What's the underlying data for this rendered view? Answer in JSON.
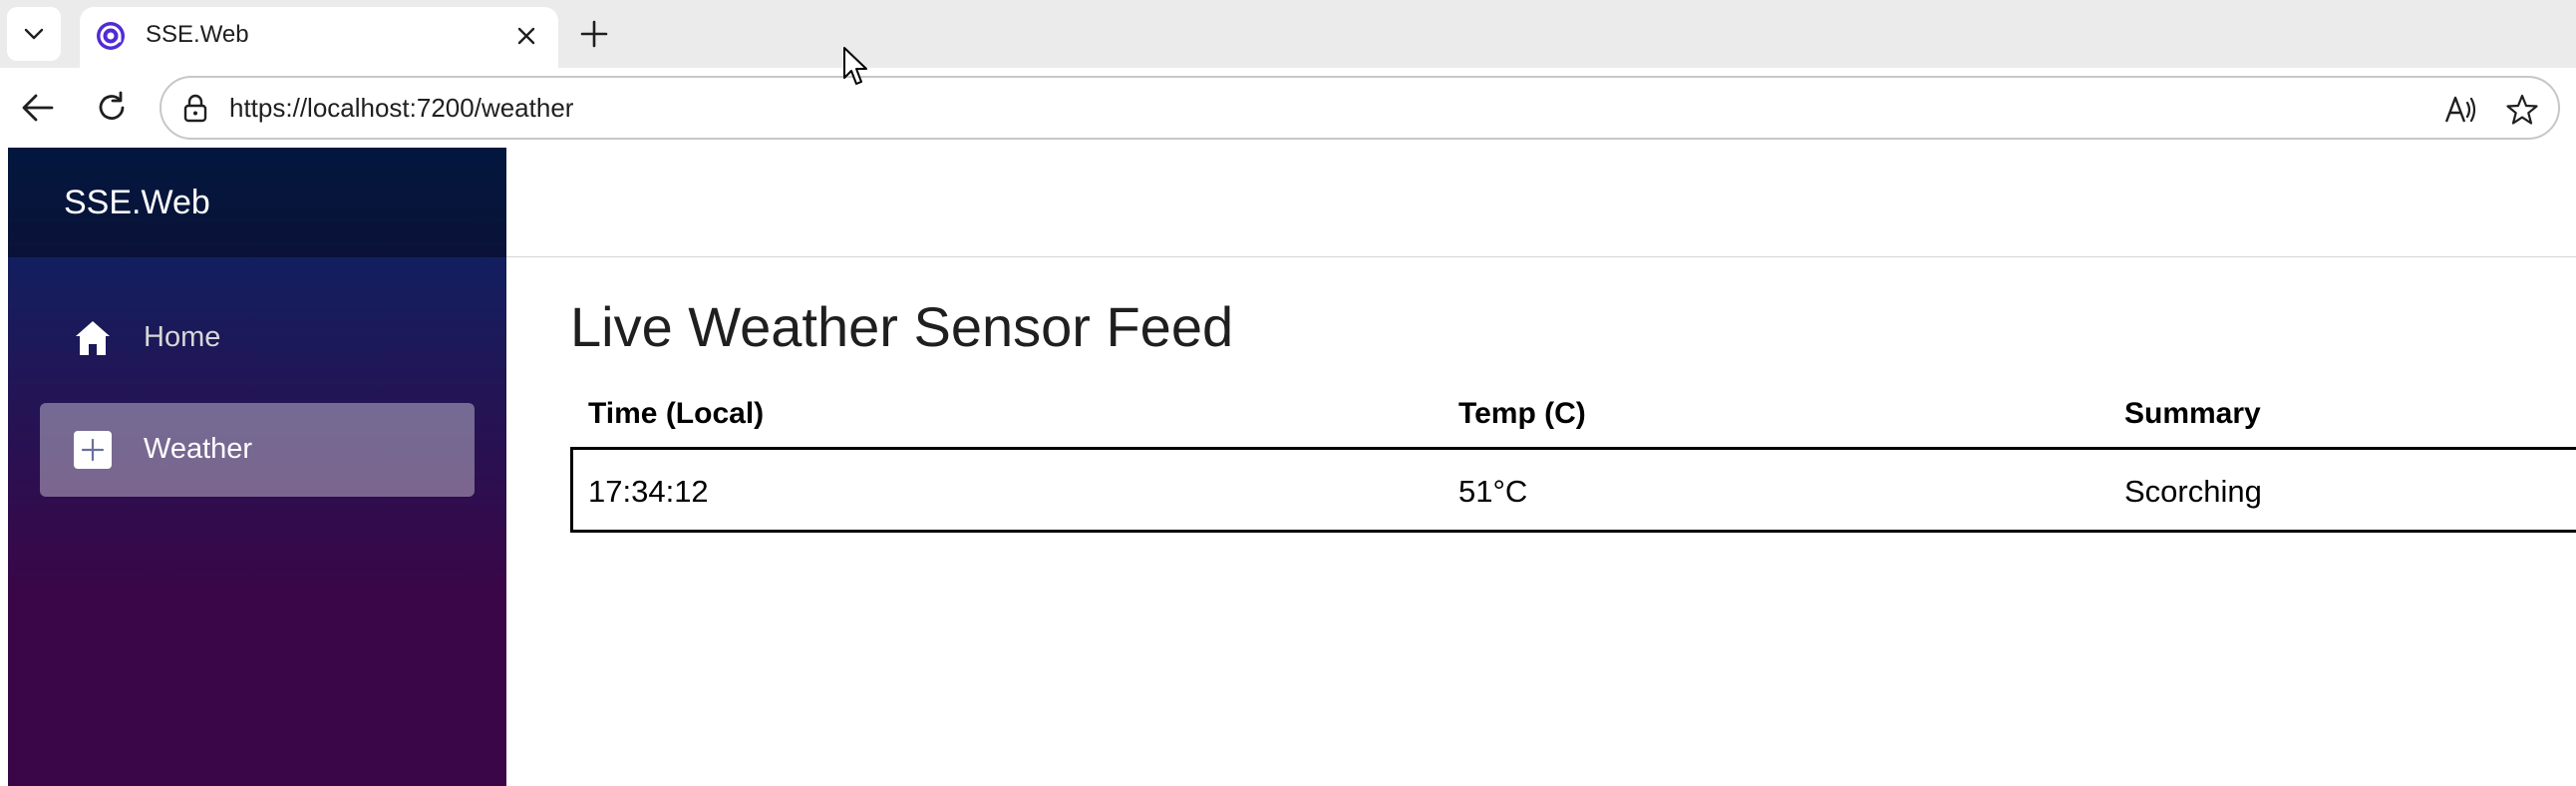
{
  "browser": {
    "tab": {
      "title": "SSE.Web"
    },
    "address_bar": {
      "url": "https://localhost:7200/weather"
    }
  },
  "sidebar": {
    "brand": "SSE.Web",
    "items": [
      {
        "label": "Home",
        "icon": "home-icon",
        "active": false
      },
      {
        "label": "Weather",
        "icon": "plus-icon",
        "active": true
      }
    ]
  },
  "main": {
    "title": "Live Weather Sensor Feed",
    "table": {
      "headers": [
        "Time (Local)",
        "Temp (C)",
        "Summary"
      ],
      "rows": [
        [
          "17:34:12",
          "51°C",
          "Scorching"
        ]
      ]
    }
  },
  "colors": {
    "sidebar_top": "#052767",
    "sidebar_bottom": "#3a0647",
    "active_nav_bg": "rgba(255,255,255,0.37)",
    "favicon_purple": "#512bd4"
  }
}
